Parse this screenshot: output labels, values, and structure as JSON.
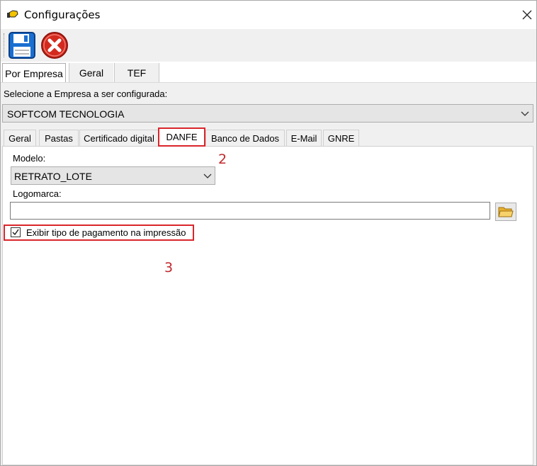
{
  "window": {
    "title": "Configurações",
    "close_label": "✕"
  },
  "toolbar": {
    "save_icon": "floppy-disk-save-icon",
    "cancel_icon": "red-circle-x-cancel-icon"
  },
  "top_tabs": [
    {
      "label": "Por Empresa",
      "selected": true
    },
    {
      "label": "Geral",
      "selected": false
    },
    {
      "label": "TEF",
      "selected": false
    }
  ],
  "empresa": {
    "label": "Selecione a Empresa a ser configurada:",
    "selected": "SOFTCOM TECNOLOGIA"
  },
  "sub_tabs": [
    {
      "label": "Geral",
      "selected": false
    },
    {
      "label": "Pastas",
      "selected": false
    },
    {
      "label": "Certificado digital",
      "selected": false
    },
    {
      "label": "DANFE",
      "selected": true
    },
    {
      "label": "Banco de Dados",
      "selected": false
    },
    {
      "label": "E-Mail",
      "selected": false
    },
    {
      "label": "GNRE",
      "selected": false
    }
  ],
  "danfe": {
    "modelo_label": "Modelo:",
    "modelo_value": "RETRATO_LOTE",
    "logomarca_label": "Logomarca:",
    "logomarca_value": "",
    "checkbox_label": "Exibir tipo de pagamento na impressão",
    "checkbox_checked": true
  },
  "annotations": {
    "step2": "2",
    "step3": "3",
    "highlight_color": "#d9262b"
  }
}
